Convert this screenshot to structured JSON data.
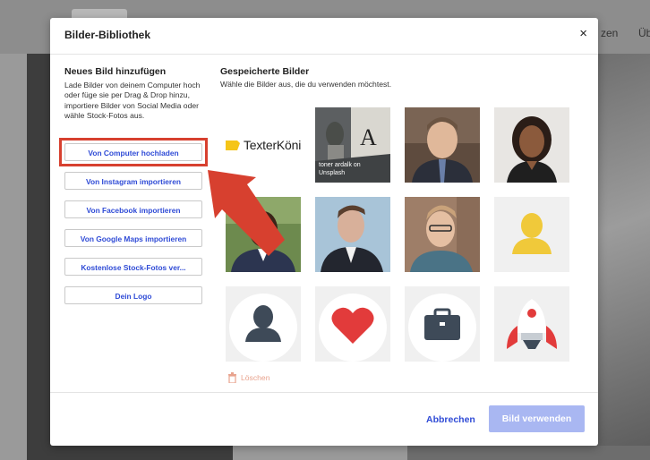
{
  "background": {
    "nav_items": [
      "zen",
      "Üb"
    ]
  },
  "modal": {
    "title": "Bilder-Bibliothek",
    "close_label": "×",
    "left": {
      "section_title": "Neues Bild hinzufügen",
      "description": "Lade Bilder von deinem Computer hoch oder füge sie per Drag & Drop hinzu, importiere Bilder von Social Media oder wähle Stock-Fotos aus.",
      "buttons": [
        "Von Computer hochladen",
        "Von Instagram importieren",
        "Von Facebook importieren",
        "Von Google Maps importieren",
        "Kostenlose Stock-Fotos ver...",
        "Dein Logo"
      ]
    },
    "right": {
      "section_title": "Gespeicherte Bilder",
      "description": "Wähle die Bilder aus, die du verwenden möchtest.",
      "logo_text": "TexterKönig",
      "photo_credit": "toner ardalk on Unsplash",
      "delete_label": "Löschen"
    },
    "footer": {
      "cancel_label": "Abbrechen",
      "use_label": "Bild verwenden"
    }
  },
  "colors": {
    "accent_blue": "#2f4bd6",
    "use_button_disabled": "#a9b7f2",
    "highlight_red": "#d7402f",
    "logo_yellow": "#f5c518",
    "heart_red": "#e23b3b",
    "avatar_slate": "#3e4a58",
    "avatar_yellow": "#f0c93a"
  }
}
